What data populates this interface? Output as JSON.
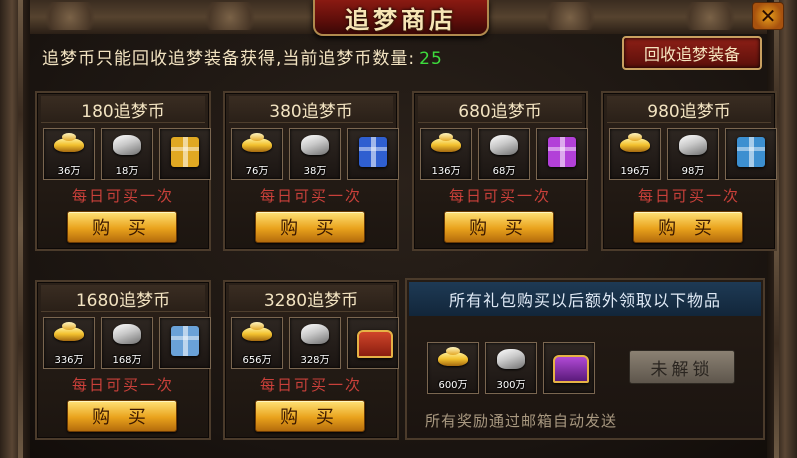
{
  "title": "追梦商店",
  "close_label": "✕",
  "info": {
    "text": "追梦币只能回收追梦装备获得,当前追梦币数量:",
    "count": "25"
  },
  "recycle_button": "回收追梦装备",
  "packs": [
    {
      "price": "180追梦币",
      "items": [
        {
          "icon": "gold-ingot-icon",
          "qty": "36万"
        },
        {
          "icon": "silver-ingot-icon",
          "qty": "18万"
        },
        {
          "icon": "gift-box-gold-icon",
          "qty": ""
        }
      ],
      "gift_color": "#e0a822",
      "daily": "每日可买一次",
      "buy": "购 买"
    },
    {
      "price": "380追梦币",
      "items": [
        {
          "icon": "gold-ingot-icon",
          "qty": "76万"
        },
        {
          "icon": "silver-ingot-icon",
          "qty": "38万"
        },
        {
          "icon": "gift-box-blue-icon",
          "qty": ""
        }
      ],
      "gift_color": "#2f5fd0",
      "daily": "每日可买一次",
      "buy": "购 买"
    },
    {
      "price": "680追梦币",
      "items": [
        {
          "icon": "gold-ingot-icon",
          "qty": "136万"
        },
        {
          "icon": "silver-ingot-icon",
          "qty": "68万"
        },
        {
          "icon": "gift-box-purple-icon",
          "qty": ""
        }
      ],
      "gift_color": "#b240d8",
      "daily": "每日可买一次",
      "buy": "购 买"
    },
    {
      "price": "980追梦币",
      "items": [
        {
          "icon": "gold-ingot-icon",
          "qty": "196万"
        },
        {
          "icon": "silver-ingot-icon",
          "qty": "98万"
        },
        {
          "icon": "gift-box-teal-icon",
          "qty": ""
        }
      ],
      "gift_color": "#3c8fd0",
      "daily": "每日可买一次",
      "buy": "购 买"
    },
    {
      "price": "1680追梦币",
      "items": [
        {
          "icon": "gold-ingot-icon",
          "qty": "336万"
        },
        {
          "icon": "silver-ingot-icon",
          "qty": "168万"
        },
        {
          "icon": "gift-box-lightblue-icon",
          "qty": ""
        }
      ],
      "gift_color": "#6aa2d8",
      "daily": "每日可买一次",
      "buy": "购 买"
    },
    {
      "price": "3280追梦币",
      "items": [
        {
          "icon": "gold-ingot-icon",
          "qty": "656万"
        },
        {
          "icon": "silver-ingot-icon",
          "qty": "328万"
        },
        {
          "icon": "treasure-chest-icon",
          "qty": ""
        }
      ],
      "gift_color": "#c23a22",
      "daily": "每日可买一次",
      "buy": "购 买"
    }
  ],
  "bonus": {
    "header": "所有礼包购买以后额外领取以下物品",
    "items": [
      {
        "icon": "gold-ingot-icon",
        "qty": "600万"
      },
      {
        "icon": "silver-ingot-icon",
        "qty": "300万"
      },
      {
        "icon": "purple-chest-icon",
        "qty": ""
      }
    ],
    "locked_label": "未解锁",
    "note": "所有奖励通过邮箱自动发送"
  }
}
